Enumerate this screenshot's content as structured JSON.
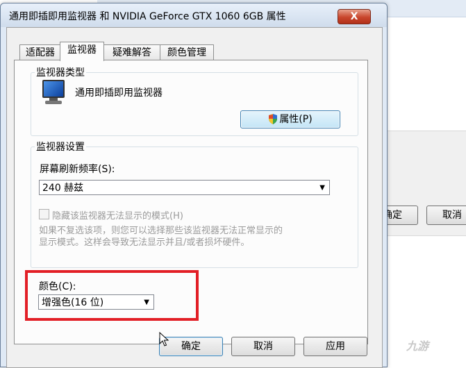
{
  "background": {
    "ok_label": "确定",
    "cancel_label": "取消"
  },
  "dialog": {
    "title": "通用即插即用监视器 和 NVIDIA GeForce GTX 1060 6GB 属性",
    "close_glyph": "X",
    "tabs": [
      {
        "label": "适配器"
      },
      {
        "label": "监视器"
      },
      {
        "label": "疑难解答"
      },
      {
        "label": "颜色管理"
      }
    ],
    "active_tab": "监视器"
  },
  "monitor_type": {
    "group_label": "监视器类型",
    "monitor_name": "通用即插即用监视器",
    "properties_button": "属性(P)"
  },
  "monitor_settings": {
    "group_label": "监视器设置",
    "refresh_label": "屏幕刷新频率(S):",
    "refresh_value": "240 赫兹",
    "hide_modes_label": "隐藏该监视器无法显示的模式(H)",
    "hide_modes_checked": false,
    "hint_line1": "如果不复选该项，则您可以选择那些该监视器无法正常显示的",
    "hint_line2": "显示模式。这样会导致无法显示并且/或者损坏硬件。"
  },
  "color": {
    "label": "颜色(C):",
    "value": "增强色(16 位)"
  },
  "buttons": {
    "ok": "确定",
    "cancel": "取消",
    "apply": "应用"
  },
  "watermark": "九游",
  "colors": {
    "highlight": "#e21f26",
    "title_bar": "#dfe9f5",
    "close_button": "#c8452c"
  }
}
